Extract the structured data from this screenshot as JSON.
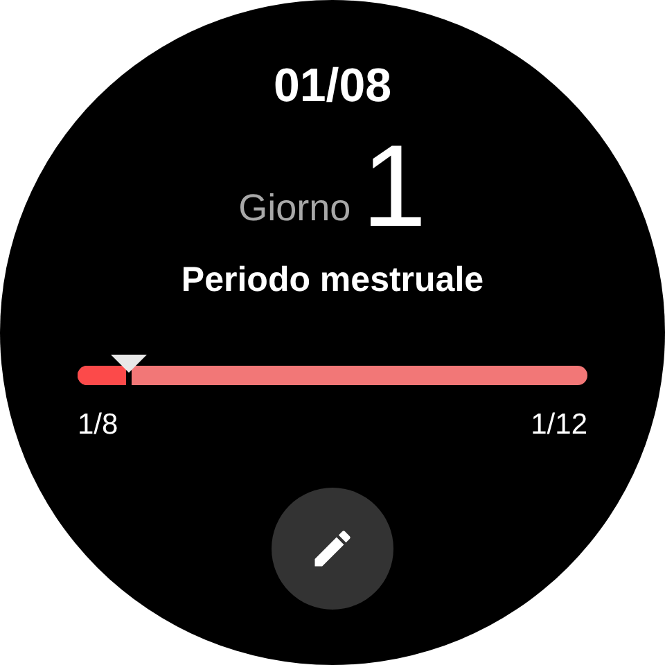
{
  "date": "01/08",
  "day_label": "Giorno",
  "day_number": "1",
  "phase": "Periodo mestruale",
  "cycle": {
    "level": 0.1,
    "start": "1/8",
    "end": "1/12"
  },
  "edit_button": {
    "kind": "edit"
  }
}
